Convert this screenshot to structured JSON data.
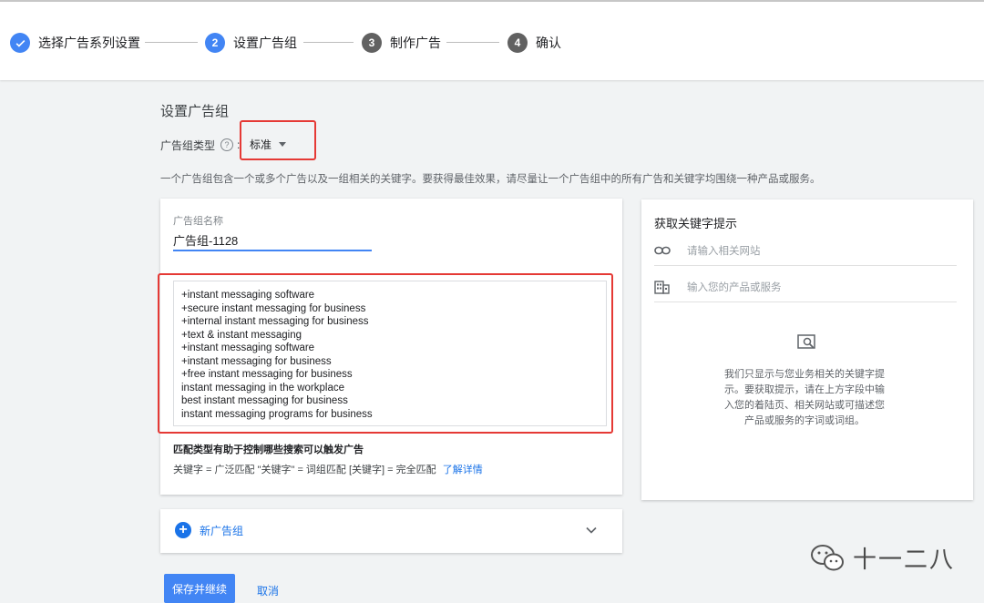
{
  "stepper": {
    "steps": [
      {
        "num": "1",
        "label": "选择广告系列设置",
        "state": "done"
      },
      {
        "num": "2",
        "label": "设置广告组",
        "state": "active"
      },
      {
        "num": "3",
        "label": "制作广告",
        "state": "pending"
      },
      {
        "num": "4",
        "label": "确认",
        "state": "pending"
      }
    ]
  },
  "section": {
    "title": "设置广告组",
    "type_label": "广告组类型",
    "type_help": "?",
    "type_value": "标准",
    "description": "一个广告组包含一个或多个广告以及一组相关的关键字。要获得最佳效果，请尽量让一个广告组中的所有广告和关键字均围绕一种产品或服务。"
  },
  "adgroup": {
    "name_label": "广告组名称",
    "name_value": "广告组-1128",
    "keywords": [
      "+instant messaging software",
      "+secure instant messaging for business",
      "+internal instant messaging for business",
      "+text & instant messaging",
      "+instant messaging software",
      "+instant messaging for business",
      "+free instant messaging for business",
      "instant messaging in the workplace",
      "best instant messaging for business",
      "instant messaging programs for business"
    ],
    "match_title": "匹配类型有助于控制哪些搜索可以触发广告",
    "match_desc": "关键字 = 广泛匹配 \"关键字\" = 词组匹配 [关键字] = 完全匹配",
    "learn_more": "了解详情"
  },
  "keyword_panel": {
    "title": "获取关键字提示",
    "website_placeholder": "请输入相关网站",
    "product_placeholder": "输入您的产品或服务",
    "info_lines": [
      "我们只显示与您业务相关的关键字提",
      "示。要获取提示，请在上方字段中输",
      "入您的着陆页、相关网站或可描述您",
      "产品或服务的字词或词组。"
    ]
  },
  "new_group": {
    "label": "新广告组"
  },
  "actions": {
    "save": "保存并继续",
    "cancel": "取消"
  },
  "watermark": {
    "text": "十一二八"
  },
  "colors": {
    "accent": "#1a73e8",
    "highlight": "#e53935",
    "step_done": "#4285f4",
    "step_pending": "#616161"
  }
}
